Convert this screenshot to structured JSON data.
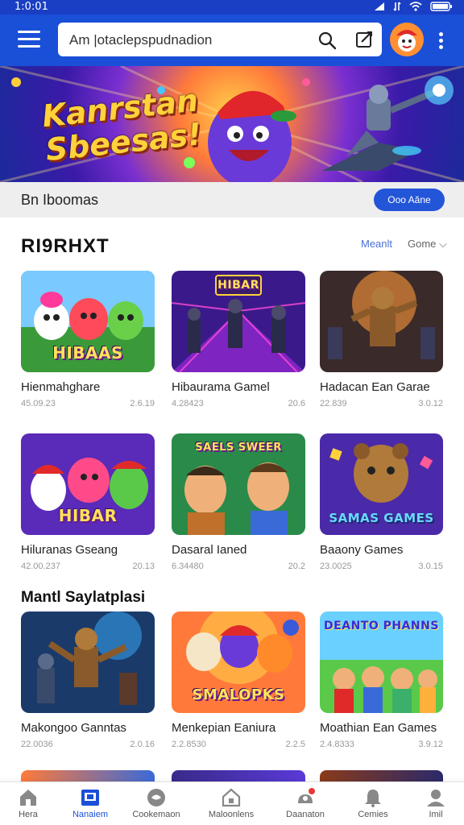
{
  "status_bar": {
    "time": "1:0:01"
  },
  "app_bar": {
    "search_text": "Am  |otaclepspudnadion",
    "icons": {
      "menu": "hamburger-icon",
      "search": "search-icon",
      "edit": "edit-icon",
      "more": "more-vertical-icon"
    }
  },
  "hero": {
    "title_line1": "Kanrstan",
    "title_line2": "Sbeesas!"
  },
  "subheader": {
    "title": "Bn Iboomas",
    "button": "Ooo Aăne"
  },
  "section": {
    "title": "RI9RHXT",
    "link": "Meanlt",
    "sort": "Gome ⌵"
  },
  "section2": {
    "title": "Mantl Saylatplasi"
  },
  "cards": [
    {
      "title": "Hienmahghare",
      "meta_left": "45.09.23",
      "meta_right": "2.6.19",
      "thumb_text": "HIBAAS"
    },
    {
      "title": "Hibaurama Gamel",
      "meta_left": "4.28423",
      "meta_right": "20.6",
      "thumb_text": "HIBAR"
    },
    {
      "title": "Hadacan Ean Garae",
      "meta_left": "22.839",
      "meta_right": "3.0.12",
      "thumb_text": ""
    },
    {
      "title": "Hiluranas Gseang",
      "meta_left": "42.00.237",
      "meta_right": "20.13",
      "thumb_text": "HIBAR"
    },
    {
      "title": "Dasaral Ianed",
      "meta_left": "6.34480",
      "meta_right": "20.2",
      "thumb_text": "SAELS SWEER"
    },
    {
      "title": "Baaony Games",
      "meta_left": "23.0025",
      "meta_right": "3.0.15",
      "thumb_text": "SAMAS GAMES"
    },
    {
      "title": "Makongoo Ganntas",
      "meta_left": "22.0036",
      "meta_right": "2.0.16",
      "thumb_text": ""
    },
    {
      "title": "Menkepian Eaniura",
      "meta_left": "2.2.8530",
      "meta_right": "2.2.5",
      "thumb_text": "SMALOPKS"
    },
    {
      "title": "Moathian Ean Games",
      "meta_left": "2.4.8333",
      "meta_right": "3.9.12",
      "thumb_text": "DEANTO PHANNS"
    }
  ],
  "bottom_nav": [
    {
      "label": "Hera",
      "icon": "home-icon"
    },
    {
      "label": "Nanaiem",
      "icon": "library-icon"
    },
    {
      "label": "Cookemaon",
      "icon": "controller-icon"
    },
    {
      "label": "Maloonlens",
      "icon": "store-icon"
    },
    {
      "label": "Daanaton",
      "icon": "notifications-icon"
    },
    {
      "label": "Cemies",
      "icon": "bell-icon"
    },
    {
      "label": "Imil",
      "icon": "profile-icon"
    }
  ],
  "colors": {
    "primary": "#1a4fd8",
    "button": "#2355d8",
    "link": "#4b6fd8"
  }
}
